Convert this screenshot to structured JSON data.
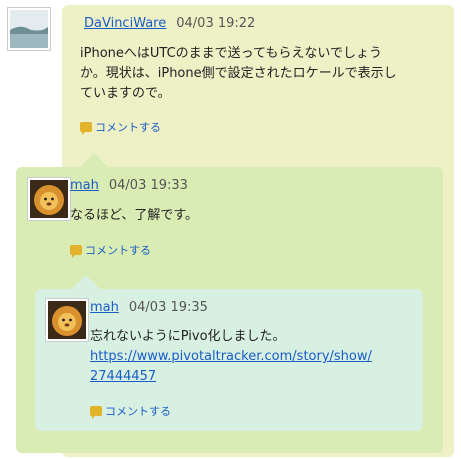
{
  "comments": [
    {
      "author": "DaVinciWare",
      "time": "04/03 19:22",
      "lines": [
        "iPhoneへはUTCのままで送ってもらえないでしょう",
        "か。現状は、iPhone側で設定されたロケールで表示し",
        "ていますので。"
      ],
      "action": "コメントする"
    },
    {
      "author": "mah",
      "time": "04/03 19:33",
      "lines": [
        "なるほど、了解です。"
      ],
      "action": "コメントする"
    },
    {
      "author": "mah",
      "time": "04/03 19:35",
      "lines": [
        "忘れないようにPivo化しました。"
      ],
      "link_lines": [
        "https://www.pivotaltracker.com/story/show/",
        "27444457"
      ],
      "action": "コメントする"
    }
  ],
  "colors": {
    "level1_bg": "#eef0c6",
    "level2_bg": "#d9ecb3",
    "level3_bg": "#d7f0e2",
    "link": "#1a5cc8",
    "comment_icon": "#e3b32c"
  }
}
